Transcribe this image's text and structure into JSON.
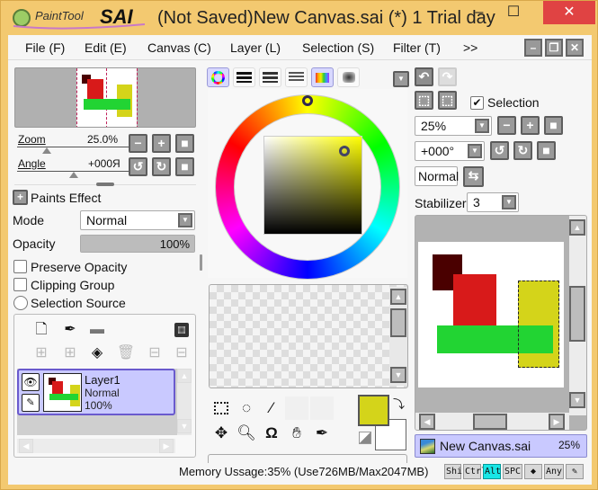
{
  "app": {
    "logo_text": "PaintTool SAI",
    "title": "(Not Saved)New Canvas.sai (*) 1 Trial day",
    "window_buttons": {
      "minimize": "–",
      "maximize": "☐",
      "close": "✕"
    }
  },
  "menu": {
    "items": [
      {
        "label": "File (F)"
      },
      {
        "label": "Edit (E)"
      },
      {
        "label": "Canvas (C)"
      },
      {
        "label": "Layer (L)"
      },
      {
        "label": "Selection (S)"
      },
      {
        "label": "Filter (T)"
      },
      {
        "label": ">>"
      }
    ],
    "mdi_buttons": {
      "minimize": "–",
      "restore": "❐",
      "close": "✕"
    }
  },
  "navigator": {
    "zoom_label": "Zoom",
    "zoom_value": "25.0%",
    "angle_label": "Angle",
    "angle_value": "+000Я",
    "buttons": {
      "zoom_out": "−",
      "zoom_in": "+",
      "reset": "■",
      "rotate_ccw": "↺",
      "rotate_cw": "↻",
      "reset_angle": "■"
    }
  },
  "layer_props": {
    "paints_effect": "Paints Effect",
    "mode_label": "Mode",
    "mode_value": "Normal",
    "opacity_label": "Opacity",
    "opacity_value": "100%",
    "opacity_fraction": 1.0,
    "preserve_opacity": "Preserve Opacity",
    "clipping_group": "Clipping Group",
    "selection_source": "Selection Source"
  },
  "layers": {
    "items": [
      {
        "name": "Layer1",
        "mode": "Normal",
        "opacity": "100%",
        "selected": true
      }
    ]
  },
  "color": {
    "tabs": [
      "color-wheel",
      "rgb-sliders",
      "hsv-sliders",
      "gradient-sliders",
      "swatches",
      "scratchpad"
    ],
    "active_tabs": [
      0,
      4
    ],
    "hue_deg": 60,
    "primary_color": "#d4d41a",
    "secondary_color": "#ffffff"
  },
  "tools_row1": [
    "select-rect",
    "lasso",
    "magic-wand",
    "",
    ""
  ],
  "tools_row2": [
    "move",
    "zoom",
    "rotate",
    "hand",
    "eyedropper"
  ],
  "right_controls": {
    "selection_label": "Selection",
    "selection_checked": true,
    "zoom_value": "25%",
    "angle_value": "+000°",
    "blend_label": "Normal",
    "stabilizer_label": "Stabilizer",
    "stabilizer_value": "3"
  },
  "canvas_tab": {
    "name": "New Canvas.sai",
    "zoom": "25%"
  },
  "status": {
    "memory": "Memory Ussage:35% (Use726MB/Max2047MB)",
    "modifiers": [
      {
        "label": "Shift",
        "active": false
      },
      {
        "label": "Ctrl",
        "active": false
      },
      {
        "label": "Alt",
        "active": true
      },
      {
        "label": "SPC",
        "active": false
      },
      {
        "label": "◆",
        "active": false
      },
      {
        "label": "Any",
        "active": false
      },
      {
        "label": "✎",
        "active": false
      }
    ]
  },
  "colors": {
    "frame": "#f3c970",
    "dark_red": "#4a0000",
    "red": "#d81a1a",
    "yellow": "#d4d41a",
    "green": "#22d433",
    "highlight": "#c9c9ff",
    "alt_active": "#19e6e6"
  }
}
